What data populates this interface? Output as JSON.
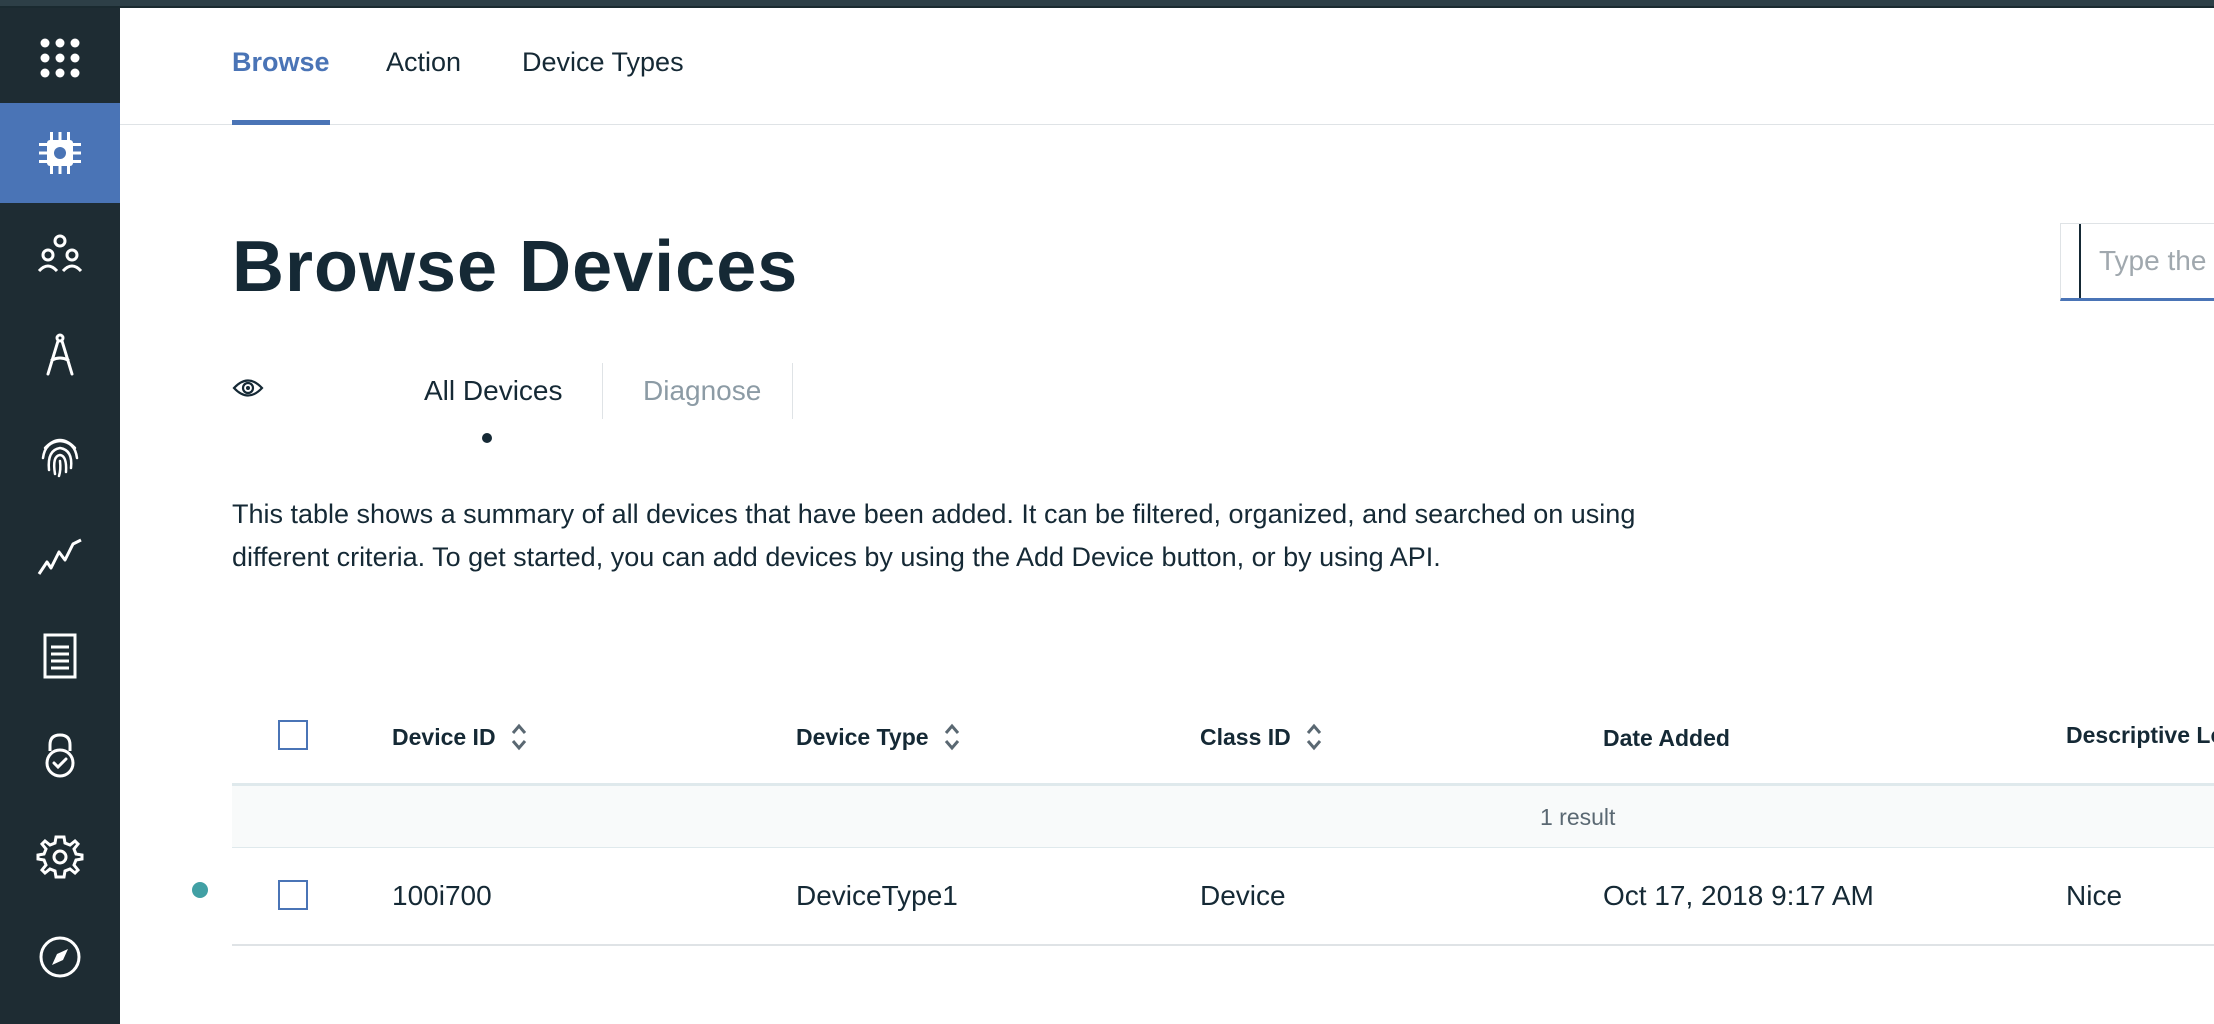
{
  "nav": {
    "tabs": [
      {
        "label": "Browse",
        "active": true
      },
      {
        "label": "Action",
        "active": false
      },
      {
        "label": "Device Types",
        "active": false
      }
    ]
  },
  "sidebar": {
    "items": [
      {
        "icon": "app-grid-icon"
      },
      {
        "icon": "chip-icon",
        "active": true
      },
      {
        "icon": "members-icon"
      },
      {
        "icon": "compass-draw-icon"
      },
      {
        "icon": "fingerprint-icon"
      },
      {
        "icon": "usage-chart-icon"
      },
      {
        "icon": "document-icon"
      },
      {
        "icon": "security-lock-icon"
      },
      {
        "icon": "gear-icon"
      },
      {
        "icon": "explore-compass-icon"
      }
    ]
  },
  "page": {
    "title": "Browse Devices",
    "search_placeholder": "Type the Device ID"
  },
  "views": {
    "all_devices": "All Devices",
    "diagnose": "Diagnose"
  },
  "description": "This table shows a summary of all devices that have been added. It can be filtered, organized, and searched on using different criteria. To get started, you can add devices by using the Add Device button, or by using API.",
  "table": {
    "columns": {
      "device_id": "Device ID",
      "device_type": "Device Type",
      "class_id": "Class ID",
      "date_added": "Date Added",
      "descriptive_location": "Descriptive Location"
    },
    "result_count": "1 result",
    "rows": [
      {
        "device_id": "100i700",
        "device_type": "DeviceType1",
        "class_id": "Device",
        "date_added": "Oct 17, 2018 9:17 AM",
        "descriptive_location": "Nice",
        "status_color": "#41a0a4"
      }
    ]
  },
  "colors": {
    "accent": "#4a74b6",
    "sidebar": "#1e2c33",
    "status_connected": "#41a0a4"
  }
}
